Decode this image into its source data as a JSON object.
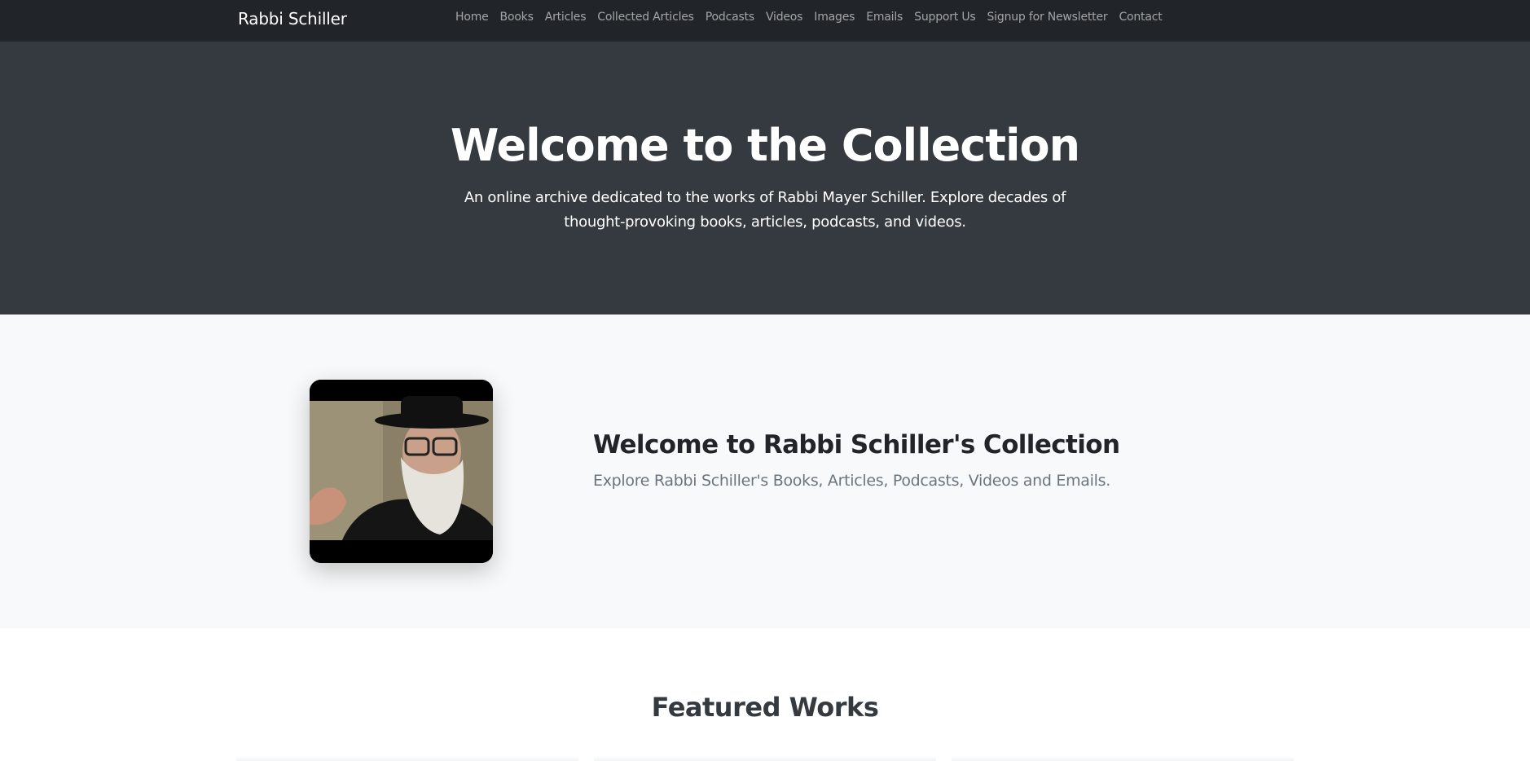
{
  "navbar": {
    "brand": "Rabbi Schiller",
    "links": [
      "Home",
      "Books",
      "Articles",
      "Collected Articles",
      "Podcasts",
      "Videos",
      "Images",
      "Emails",
      "Support Us",
      "Signup for Newsletter",
      "Contact"
    ]
  },
  "hero": {
    "title": "Welcome to the Collection",
    "subtitle": "An online archive dedicated to the works of Rabbi Mayer Schiller. Explore decades of thought-provoking books, articles, podcasts, and videos."
  },
  "intro": {
    "title": "Welcome to Rabbi Schiller's Collection",
    "text": "Explore Rabbi Schiller's Books, Articles, Podcasts, Videos and Emails."
  },
  "featured": {
    "title": "Featured Works"
  },
  "colors": {
    "navbar_bg": "#212529",
    "hero_bg": "#343a40",
    "intro_bg": "#f8f9fa"
  }
}
